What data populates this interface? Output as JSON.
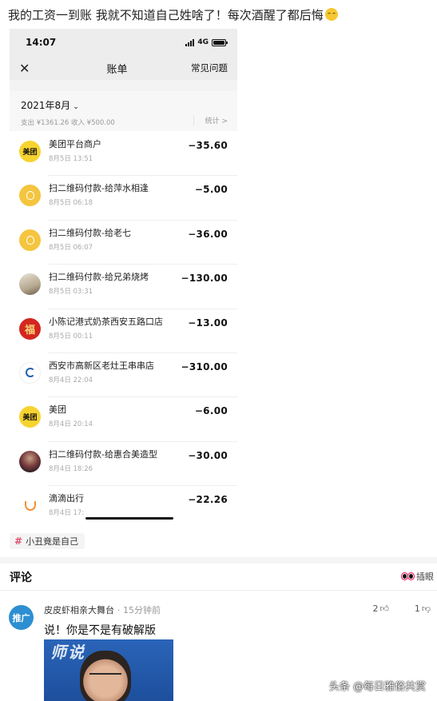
{
  "post": {
    "text": "我的工资一到账 我就不知道自己姓啥了！每次酒醒了都后悔",
    "emoji": "smirk-face-emoji"
  },
  "phone": {
    "status_time": "14:07",
    "network": "4G",
    "nav_title": "账单",
    "nav_faq": "常见问题",
    "month": "2021年8月",
    "summary": "支出 ¥1361.26 收入 ¥500.00",
    "stats": "统计 >",
    "transactions": [
      {
        "name": "美团平台商户",
        "date": "8月5日 13:51",
        "amount": "−35.60",
        "icon": "meituan-icon",
        "icon_text": "美团"
      },
      {
        "name": "扫二维码付款-给萍水相逢",
        "date": "8月5日 06:18",
        "amount": "−5.00",
        "icon": "money-bag-icon",
        "icon_text": ""
      },
      {
        "name": "扫二维码付款-给老七",
        "date": "8月5日 06:07",
        "amount": "−36.00",
        "icon": "money-bag-icon",
        "icon_text": ""
      },
      {
        "name": "扫二维码付款-给兄弟烧烤",
        "date": "8月5日 03:31",
        "amount": "−130.00",
        "icon": "photo-avatar-icon",
        "icon_text": ""
      },
      {
        "name": "小陈记港式奶茶西安五路口店",
        "date": "8月5日 00:11",
        "amount": "−13.00",
        "icon": "fu-logo-icon",
        "icon_text": "福"
      },
      {
        "name": "西安市高新区老灶王串串店",
        "date": "8月4日 22:04",
        "amount": "−310.00",
        "icon": "bank-logo-icon",
        "icon_text": ""
      },
      {
        "name": "美团",
        "date": "8月4日 20:14",
        "amount": "−6.00",
        "icon": "meituan-icon",
        "icon_text": "美团"
      },
      {
        "name": "扫二维码付款-给惠合美造型",
        "date": "8月4日 18:26",
        "amount": "−30.00",
        "icon": "photo-avatar-icon",
        "icon_text": ""
      },
      {
        "name": "滴滴出行",
        "date": "8月4日 17:",
        "amount": "−22.26",
        "icon": "didi-icon",
        "icon_text": ""
      }
    ]
  },
  "topic": "小丑竟是自己",
  "comments": {
    "title": "评论",
    "insert_eye": "插眼",
    "items": [
      {
        "avatar_text": "推广",
        "author": "皮皮虾相亲大舞台",
        "ago": "· 15分钟前",
        "likes": "2",
        "dislikes": "1",
        "text": "说！你是不是有破解版",
        "image_text": "师说"
      }
    ]
  },
  "watermark": "头条 @每日雅俗共赏"
}
